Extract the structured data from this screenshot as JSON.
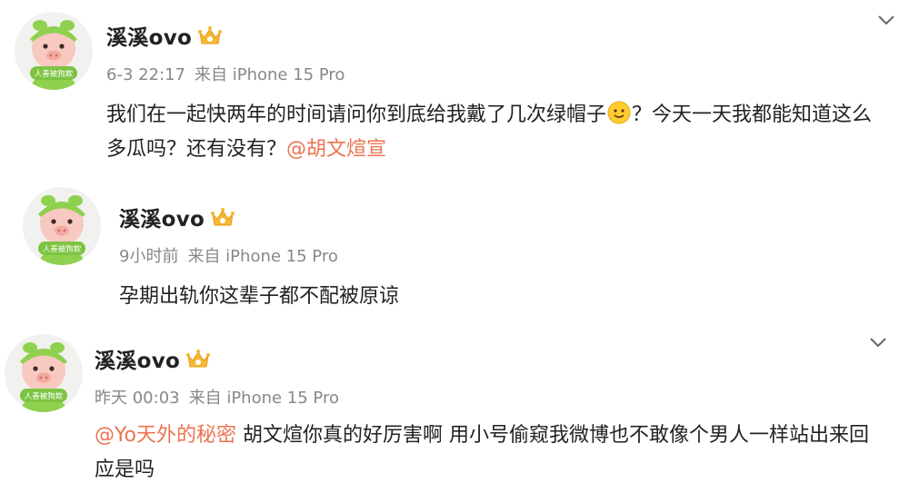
{
  "posts": [
    {
      "avatar_badge": "人善被狗欺",
      "username": "溪溪ovo",
      "time": "6-3 22:17",
      "source": "来自 iPhone 15 Pro",
      "text_1": "我们在一起快两年的时间请问你到底给我戴了几次绿帽子",
      "text_2": "？今天一天我都能知道这么多瓜吗？还有没有？",
      "mention": "@胡文煊宣"
    },
    {
      "avatar_badge": "人善被狗欺",
      "username": "溪溪ovo",
      "time": "9小时前",
      "source": "来自 iPhone 15 Pro",
      "text": "孕期出轨你这辈子都不配被原谅"
    },
    {
      "avatar_badge": "人善被狗欺",
      "username": "溪溪ovo",
      "time": "昨天 00:03",
      "source": "来自 iPhone 15 Pro",
      "mention": "@Yo天外的秘密",
      "text": " 胡文煊你真的好厉害啊 用小号偷窥我微博也不敢像个男人一样站出来回应是吗"
    }
  ],
  "icons": {
    "crown": "crown-icon",
    "emoji": "smile-emoji-icon",
    "chevron": "chevron-down-icon"
  },
  "colors": {
    "mention": "#eb7350",
    "meta": "#888888",
    "avatar_green": "#8fd14f",
    "crown_gold": "#f5b833"
  }
}
